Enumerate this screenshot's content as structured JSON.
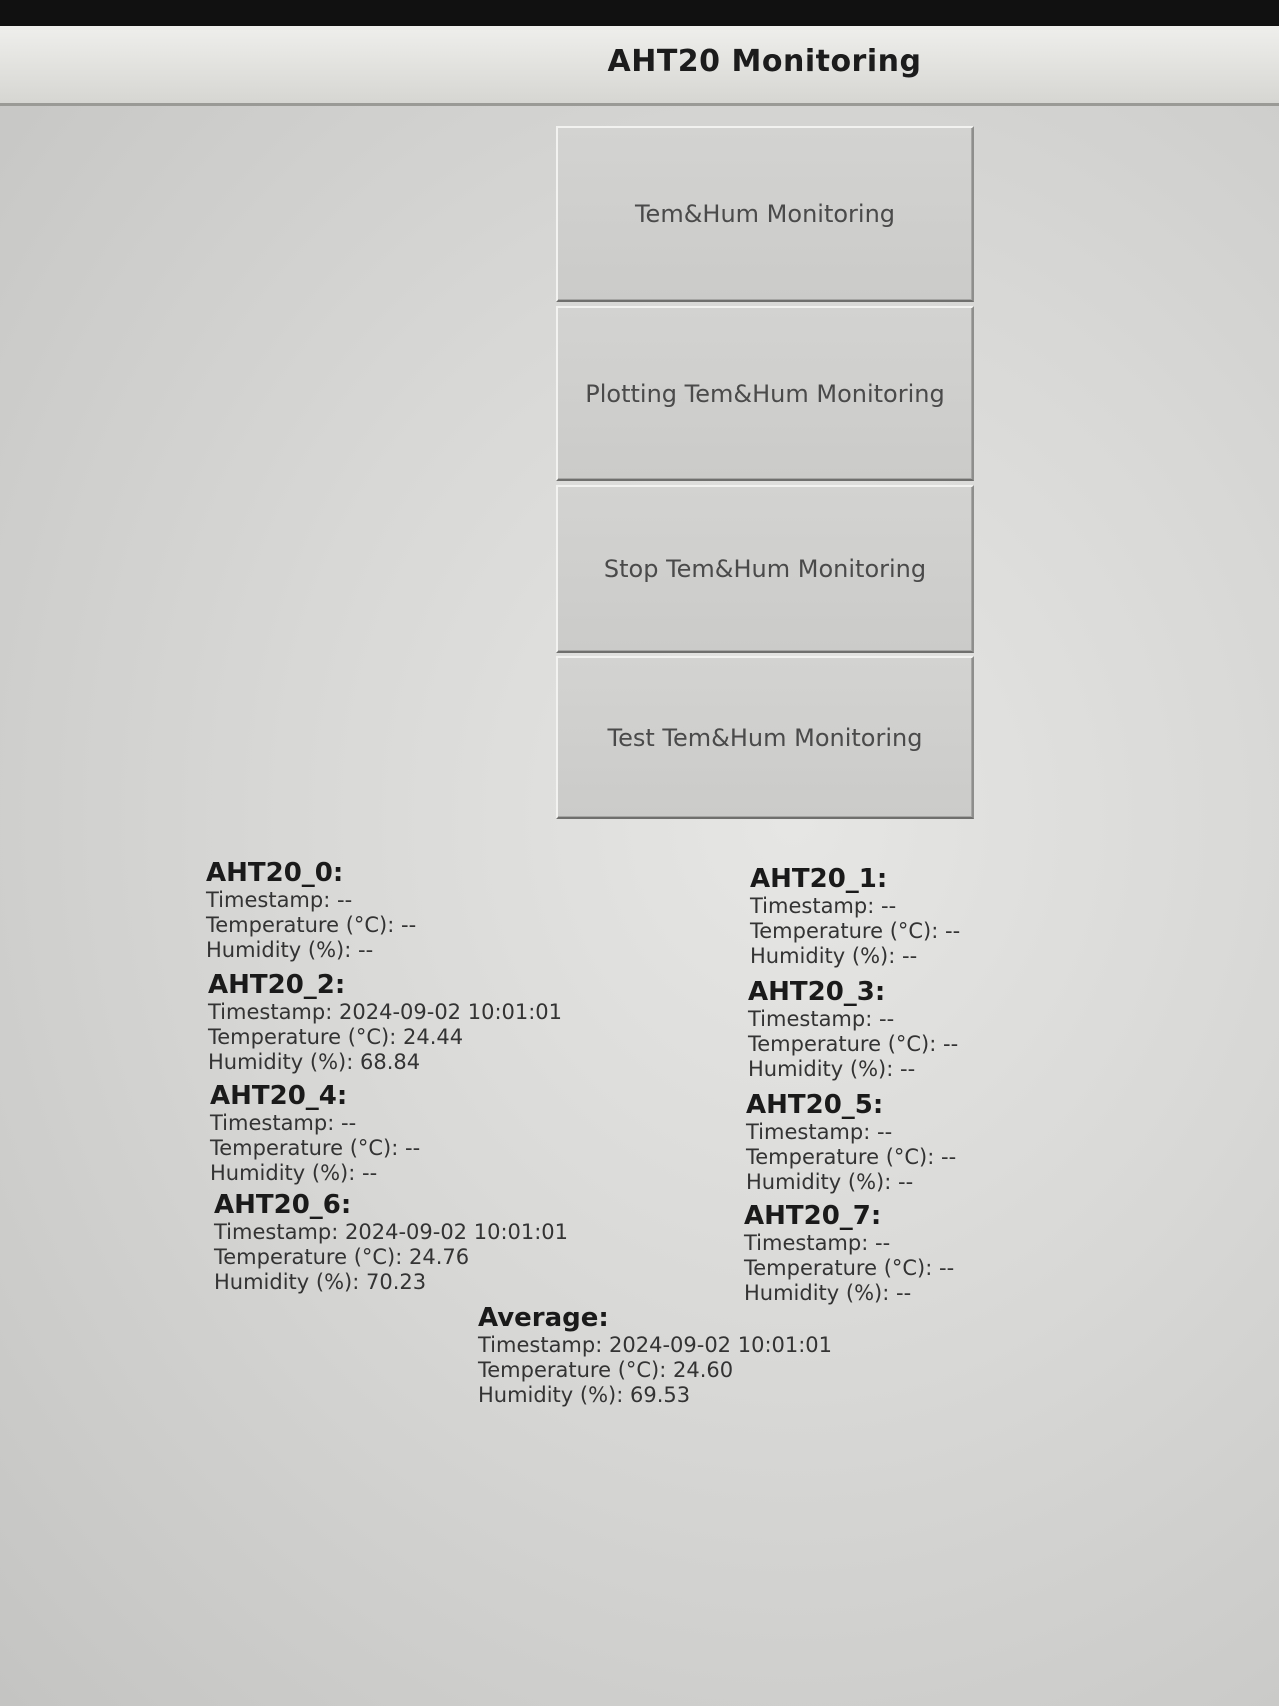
{
  "window": {
    "title": "AHT20 Monitoring"
  },
  "buttons": {
    "monitor": "Tem&Hum Monitoring",
    "plot": "Plotting Tem&Hum Monitoring",
    "stop": "Stop Tem&Hum Monitoring",
    "test": "Test Tem&Hum Monitoring"
  },
  "labels": {
    "timestamp": "Timestamp:",
    "temperature": "Temperature (°C):",
    "humidity": "Humidity (%):"
  },
  "sensors": [
    {
      "name": "AHT20_0:",
      "timestamp": "--",
      "temperature": "--",
      "humidity": "--"
    },
    {
      "name": "AHT20_1:",
      "timestamp": "--",
      "temperature": "--",
      "humidity": "--"
    },
    {
      "name": "AHT20_2:",
      "timestamp": "2024-09-02 10:01:01",
      "temperature": "24.44",
      "humidity": "68.84"
    },
    {
      "name": "AHT20_3:",
      "timestamp": "--",
      "temperature": "--",
      "humidity": "--"
    },
    {
      "name": "AHT20_4:",
      "timestamp": "--",
      "temperature": "--",
      "humidity": "--"
    },
    {
      "name": "AHT20_5:",
      "timestamp": "--",
      "temperature": "--",
      "humidity": "--"
    },
    {
      "name": "AHT20_6:",
      "timestamp": "2024-09-02 10:01:01",
      "temperature": "24.76",
      "humidity": "70.23"
    },
    {
      "name": "AHT20_7:",
      "timestamp": "--",
      "temperature": "--",
      "humidity": "--"
    }
  ],
  "average": {
    "name": "Average:",
    "timestamp": "2024-09-02 10:01:01",
    "temperature": "24.60",
    "humidity": "69.53"
  }
}
